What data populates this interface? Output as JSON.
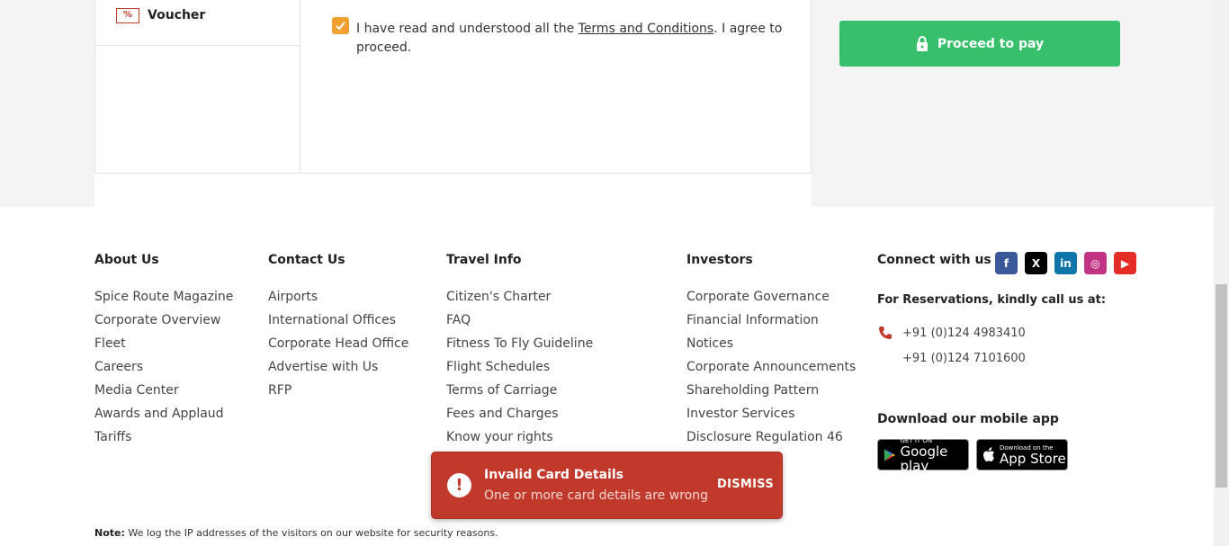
{
  "voucher": {
    "icon": "percent-ticket-icon",
    "label": "Voucher"
  },
  "terms": {
    "prefix": "I have read and understood all the ",
    "link": "Terms and Conditions",
    "suffix": ". I agree to proceed.",
    "checked": true
  },
  "proceed": {
    "label": "Proceed to pay",
    "icon": "lock-icon"
  },
  "footer": {
    "about": {
      "title": "About Us",
      "links": [
        "Spice Route Magazine",
        "Corporate Overview",
        "Fleet",
        "Careers",
        "Media Center",
        "Awards and Applaud",
        "Tariffs"
      ]
    },
    "contact": {
      "title": "Contact Us",
      "links": [
        "Airports",
        "International Offices",
        "Corporate Head Office",
        "Advertise with Us",
        "RFP"
      ]
    },
    "travel": {
      "title": "Travel Info",
      "links": [
        "Citizen's Charter",
        "FAQ",
        "Fitness To Fly Guideline",
        "Flight Schedules",
        "Terms of Carriage",
        "Fees and Charges",
        "Know your rights"
      ]
    },
    "investors": {
      "title": "Investors",
      "links": [
        "Corporate Governance",
        "Financial Information",
        "Notices",
        "Corporate Announcements",
        "Shareholding Pattern",
        "Investor Services",
        "Disclosure Regulation 46"
      ]
    },
    "connect": {
      "title": "Connect with us",
      "social": [
        {
          "name": "facebook-icon",
          "glyph": "f",
          "color": "#3b5998"
        },
        {
          "name": "x-icon",
          "glyph": "X",
          "color": "#000000"
        },
        {
          "name": "linkedin-icon",
          "glyph": "in",
          "color": "#0e76a8"
        },
        {
          "name": "instagram-icon",
          "glyph": "◎",
          "color": "#c13584"
        },
        {
          "name": "youtube-icon",
          "glyph": "▶",
          "color": "#e52d27"
        }
      ],
      "reservations": "For Reservations, kindly call us at:",
      "phones": [
        "+91 (0)124 4983410",
        "+91 (0)124 7101600"
      ],
      "app_title": "Download our mobile app",
      "google_play": {
        "small": "GET IT ON",
        "big": "Google play"
      },
      "app_store": {
        "small": "Download on the",
        "big": "App Store"
      }
    }
  },
  "note": {
    "label": "Note:",
    "text": "We log the IP addresses of the visitors on our website for security reasons."
  },
  "toast": {
    "title": "Invalid Card Details",
    "message": "One or more card details are wrong",
    "dismiss": "DISMISS",
    "icon": "!"
  }
}
